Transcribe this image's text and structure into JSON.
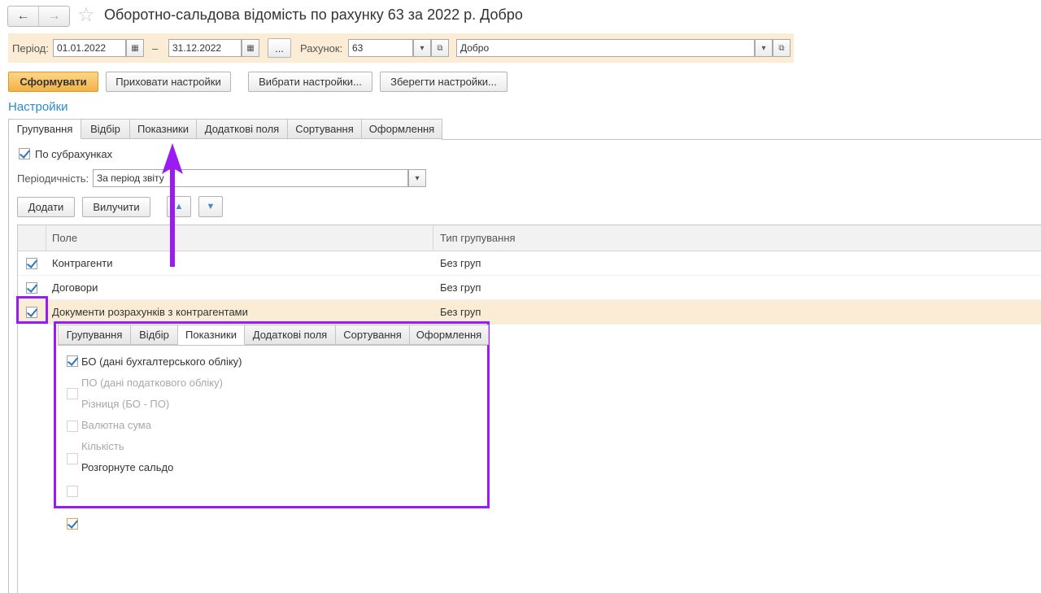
{
  "window": {
    "title": "Оборотно-сальдова відомість по рахунку 63 за 2022 р. Добро",
    "back_icon": "←",
    "forward_icon": "→",
    "favorite_icon": "☆"
  },
  "period_bar": {
    "period_label": "Період:",
    "date_from": "01.01.2022",
    "dash": "–",
    "date_to": "31.12.2022",
    "more_label": "...",
    "account_label": "Рахунок:",
    "account_value": "63",
    "org_value": "Добро",
    "calendar_icon": "▦",
    "dropdown_icon": "▾",
    "open_icon": "⧉"
  },
  "toolbar": {
    "generate_label": "Сформувати",
    "hide_settings_label": "Приховати настройки",
    "choose_settings_label": "Вибрати настройки...",
    "save_settings_label": "Зберегти настройки..."
  },
  "settings": {
    "title": "Настройки",
    "tabs": [
      "Групування",
      "Відбір",
      "Показники",
      "Додаткові поля",
      "Сортування",
      "Оформлення"
    ],
    "active_tab": "Групування",
    "by_subaccounts_label": "По субрахунках",
    "by_subaccounts_checked": true,
    "periodicity_label": "Періодичність:",
    "periodicity_value": "За період звіту",
    "add_label": "Додати",
    "remove_label": "Вилучити",
    "up_icon": "▲",
    "down_icon": "▼"
  },
  "grid": {
    "columns": [
      "Поле",
      "Тип групування"
    ],
    "rows": [
      {
        "checked": true,
        "field": "Контрагенти",
        "type": "Без груп"
      },
      {
        "checked": true,
        "field": "Договори",
        "type": "Без груп"
      },
      {
        "checked": true,
        "field": "Документи розрахунків з контрагентами",
        "type": "Без груп"
      }
    ]
  },
  "popup": {
    "tabs": [
      "Групування",
      "Відбір",
      "Показники",
      "Додаткові поля",
      "Сортування",
      "Оформлення"
    ],
    "active_tab": "Показники",
    "options": [
      {
        "label": "БО (дані бухгалтерського обліку)",
        "checked": true,
        "enabled": true
      },
      {
        "label": "ПО (дані податкового обліку)",
        "checked": false,
        "enabled": false
      },
      {
        "label": "Різниця (БО - ПО)",
        "checked": false,
        "enabled": false
      },
      {
        "label": "Валютна сума",
        "checked": false,
        "enabled": false
      },
      {
        "label": "Кількість",
        "checked": false,
        "enabled": false
      },
      {
        "label": "Розгорнуте сальдо",
        "checked": true,
        "enabled": true
      }
    ]
  },
  "colors": {
    "annotation": "#9b1cf2",
    "accent_orange": "#f4b244",
    "link_blue": "#2c8cc7",
    "highlight_row": "#fbecd6"
  }
}
